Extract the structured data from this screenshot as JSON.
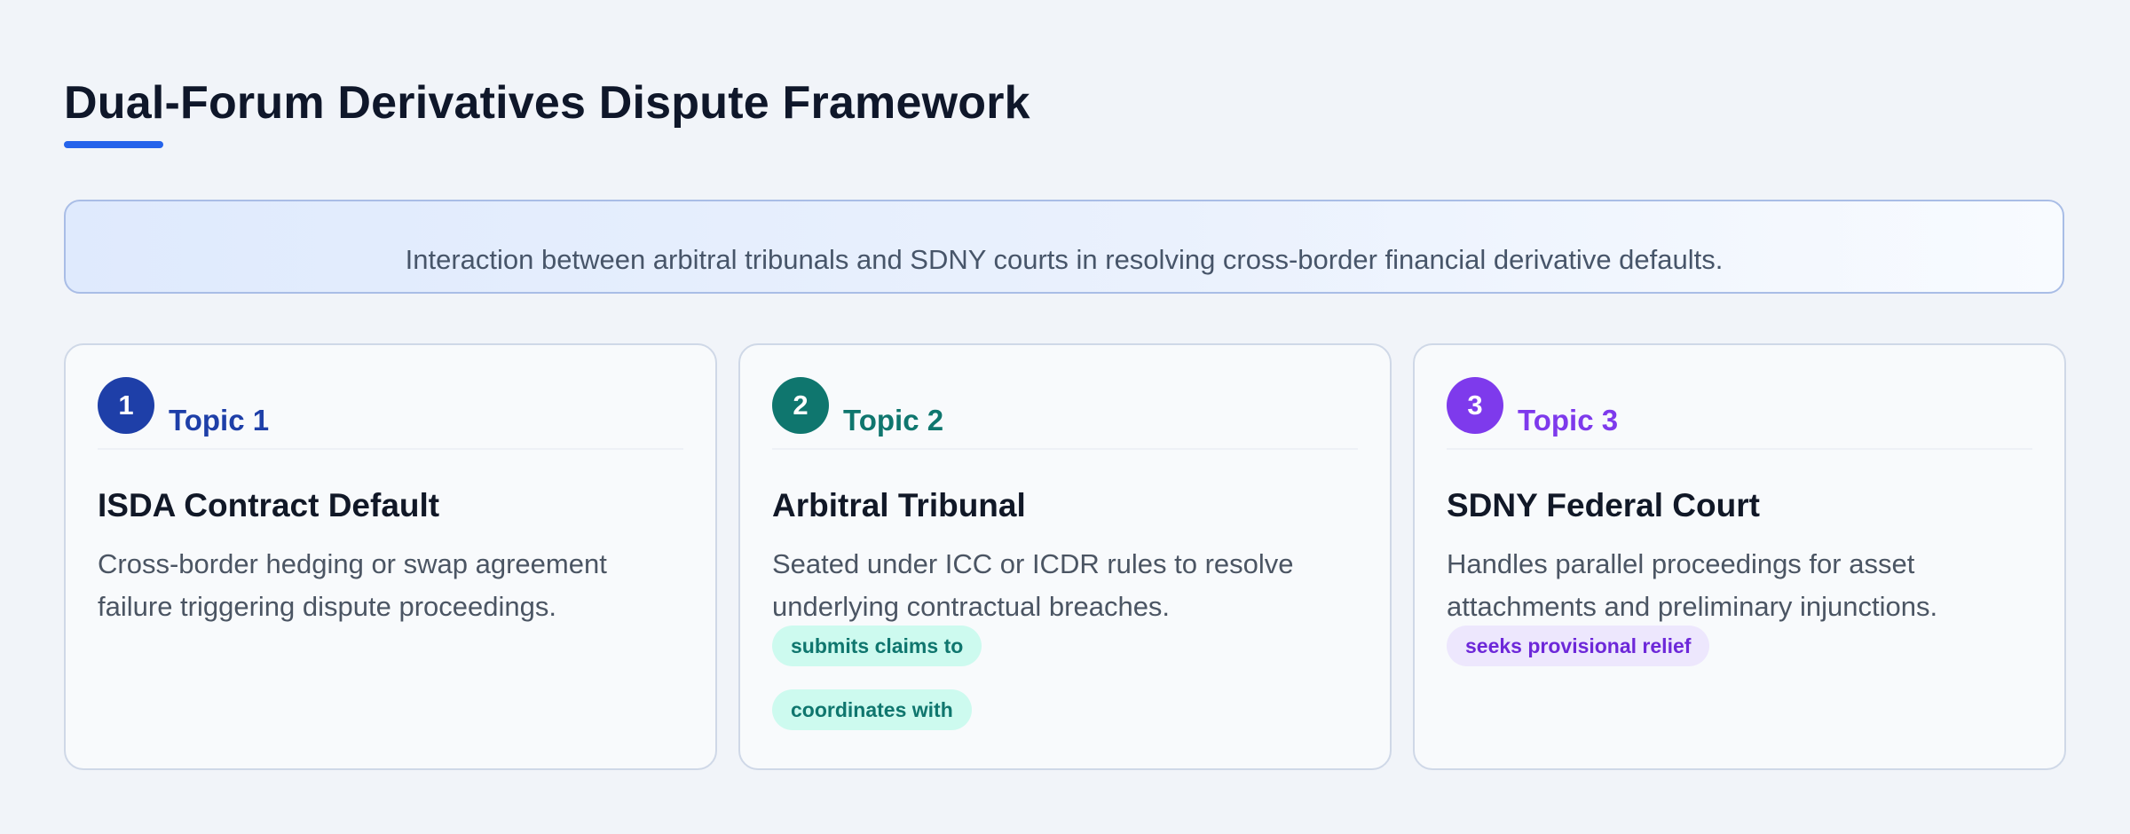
{
  "title": "Dual-Forum Derivatives Dispute Framework",
  "subtitle": "Interaction between arbitral tribunals and SDNY courts in resolving cross-border financial derivative defaults.",
  "colors": {
    "accent": "#2563eb",
    "topic1": "#1e3fa8",
    "topic2": "#0f766e",
    "topic3": "#7e3aec"
  },
  "cards": [
    {
      "number": "1",
      "topic": "Topic 1",
      "heading": "ISDA Contract Default",
      "description": "Cross-border hedging or swap agreement failure triggering dispute proceedings.",
      "chips": []
    },
    {
      "number": "2",
      "topic": "Topic 2",
      "heading": "Arbitral Tribunal",
      "description": "Seated under ICC or ICDR rules to resolve underlying contractual breaches.",
      "chips": [
        "submits claims to",
        "coordinates with"
      ]
    },
    {
      "number": "3",
      "topic": "Topic 3",
      "heading": "SDNY Federal Court",
      "description": "Handles parallel proceedings for asset attachments and preliminary injunctions.",
      "chips": [
        "seeks provisional relief"
      ]
    }
  ]
}
